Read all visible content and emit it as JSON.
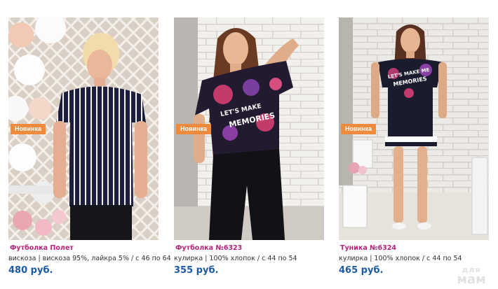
{
  "badge_label": "Новинка",
  "colors": {
    "badge": "#f08a3c",
    "product_name": "#b3247a",
    "price": "#1c5aa6"
  },
  "products": [
    {
      "name": "Футболка Полет",
      "description": "вискоза | вискоза 95%, лайкра 5% / с 46 по 64",
      "price": "480 руб."
    },
    {
      "name": "Футболка №6323",
      "description": "кулирка | 100% хлопок / с 44 по 54",
      "price": "355 руб."
    },
    {
      "name": "Туника №6324",
      "description": "кулирка | 100% хлопок / с 44 по 54",
      "price": "465 руб."
    }
  ],
  "watermark": {
    "top": "для",
    "bottom": "мам"
  }
}
